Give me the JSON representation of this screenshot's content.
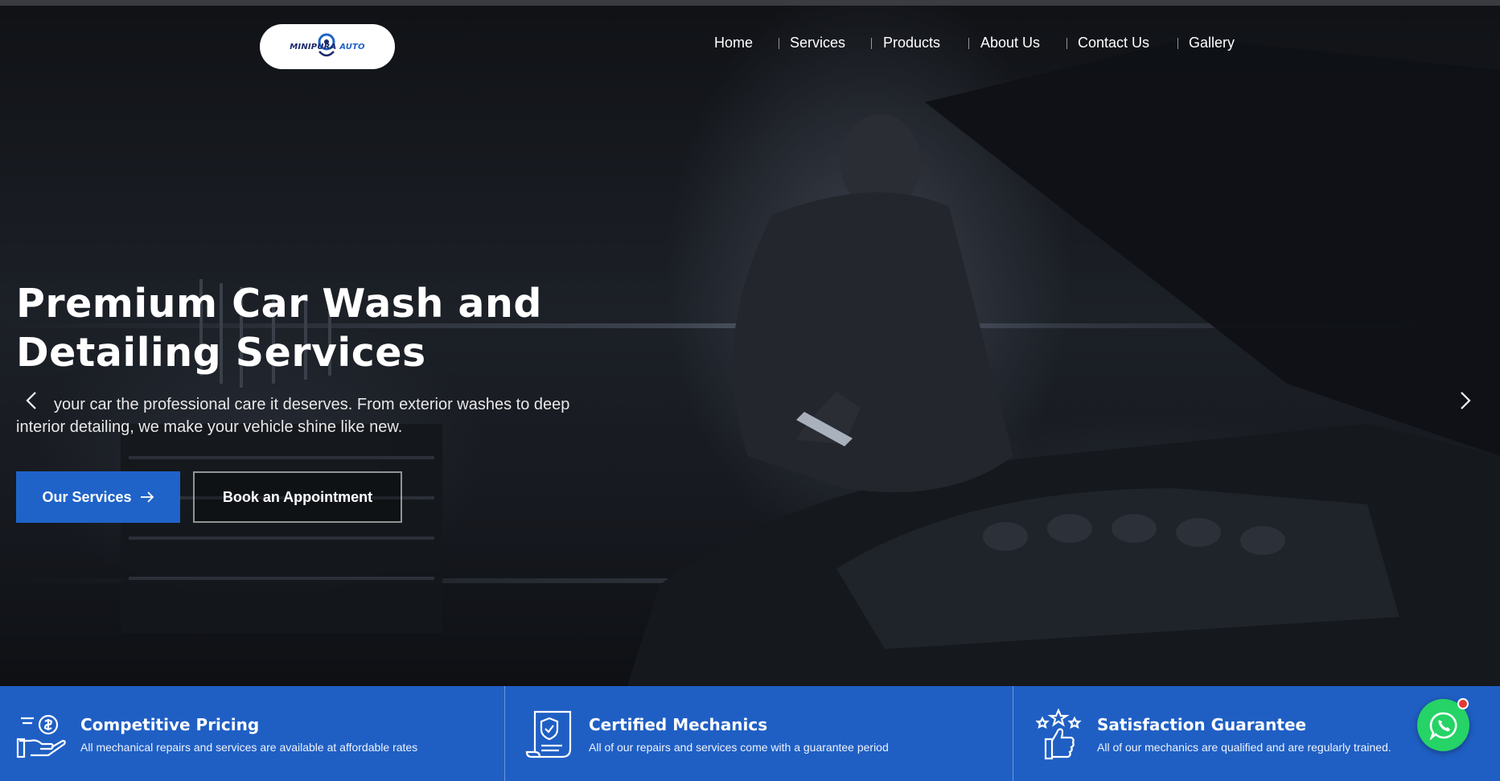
{
  "brand": {
    "logo_text_main": "MINIPURA",
    "logo_text_accent": "AUTO"
  },
  "nav": {
    "items": [
      {
        "label": "Home"
      },
      {
        "label": "Services"
      },
      {
        "label": "Products"
      },
      {
        "label": "About Us"
      },
      {
        "label": "Contact Us"
      },
      {
        "label": "Gallery"
      }
    ]
  },
  "hero": {
    "title": "Premium Car Wash and Detailing Services",
    "description": "your car the professional care it deserves. From exterior washes to deep interior detailing, we make your vehicle shine like new.",
    "primary_button": "Our Services",
    "secondary_button": "Book an Appointment",
    "prev_icon": "chevron-left-icon",
    "next_icon": "chevron-right-icon"
  },
  "features": [
    {
      "icon": "hand-money-icon",
      "title": "Competitive Pricing",
      "desc": "All mechanical repairs and services are available at affordable rates"
    },
    {
      "icon": "certificate-shield-icon",
      "title": "Certified Mechanics",
      "desc": "All of our repairs and services come with a guarantee period"
    },
    {
      "icon": "thumbs-up-stars-icon",
      "title": "Satisfaction Guarantee",
      "desc": "All of our mechanics are qualified and are regularly trained."
    }
  ],
  "colors": {
    "accent": "#1f63c9",
    "feature_bar": "#1f5fc4",
    "whatsapp": "#25d366",
    "notification": "#e53935"
  },
  "widgets": {
    "chat_icon": "whatsapp-icon"
  }
}
